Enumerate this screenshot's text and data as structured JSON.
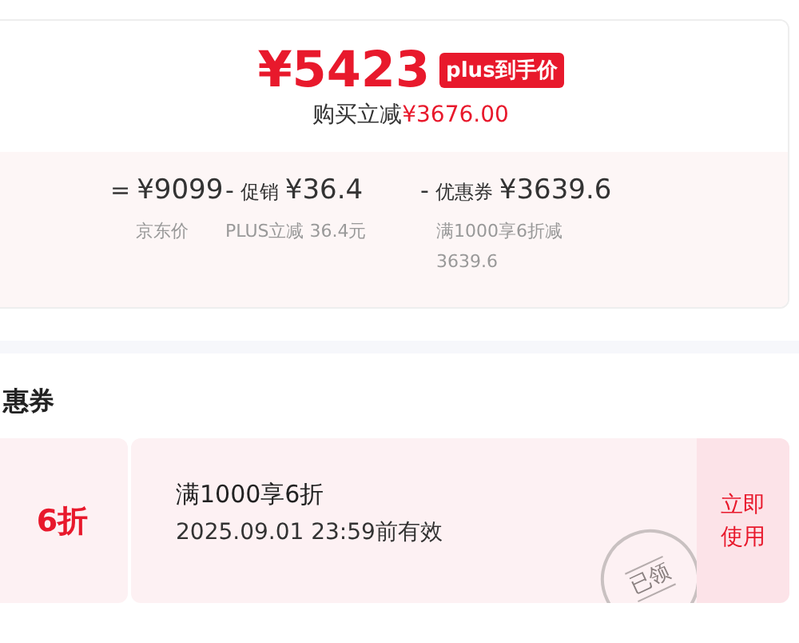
{
  "price": {
    "amount": "¥5423",
    "badge": "plus到手价",
    "saving_label": "购买立减",
    "saving_amount": "¥3676.00"
  },
  "breakdown": [
    {
      "operator": "=",
      "value": "¥9099",
      "note": "京东价"
    },
    {
      "operator": "-",
      "label": "促销",
      "value": "¥36.4",
      "note": "PLUS立减 36.4元"
    },
    {
      "operator": "-",
      "label": "优惠券",
      "value": "¥3639.6",
      "note": "满1000享6折减 3639.6"
    }
  ],
  "coupons": {
    "title": "惠券",
    "items": [
      {
        "discount": "6折",
        "condition": "满1000享6折",
        "validity": "2025.09.01 23:59前有效",
        "stamp": "已领",
        "action": "立即使用"
      }
    ]
  }
}
